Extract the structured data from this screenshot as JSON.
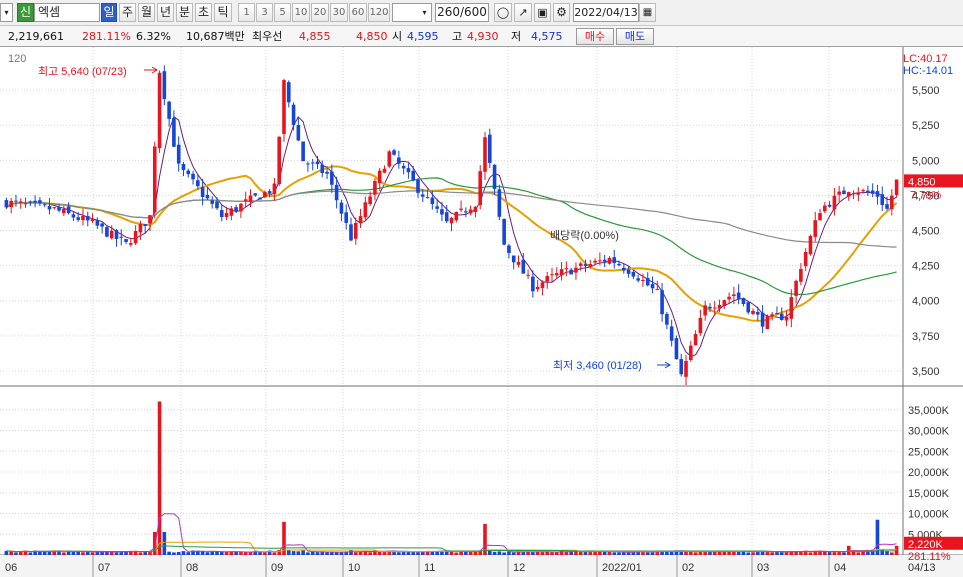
{
  "toolbar": {
    "market_badge": "신",
    "stock_name": "엑셈",
    "periods": [
      "일",
      "주",
      "월",
      "년",
      "분",
      "초",
      "틱"
    ],
    "intervals": [
      "1",
      "3",
      "5",
      "10",
      "20",
      "30",
      "60",
      "120"
    ],
    "count": "260/600",
    "date": "2022/04/13"
  },
  "info": {
    "volume": "2,219,661",
    "vol_ratio": "281.11%",
    "change_pct": "6.32%",
    "amount": "10,687백만",
    "best_bid_label": "최우선",
    "best_ask": "4,855",
    "best_bid": "4,850",
    "open_label": "시",
    "open": "4,595",
    "high_label": "고",
    "high": "4,930",
    "low_label": "저",
    "low": "4,575",
    "buy_label": "매수",
    "sell_label": "매도"
  },
  "chart_data": {
    "type": "candlestick",
    "ma_period_label": "120",
    "price_axis": {
      "ticks": [
        "5,500",
        "5,250",
        "5,000",
        "4,750",
        "4,500",
        "4,250",
        "4,000",
        "3,750",
        "3,500"
      ],
      "ylim": [
        3400,
        5750
      ]
    },
    "volume_axis": {
      "ticks": [
        "35,000K",
        "30,000K",
        "25,000K",
        "20,000K",
        "15,000K",
        "10,000K",
        "5,000K"
      ],
      "ylim": [
        0,
        40000
      ]
    },
    "x_labels": [
      "06",
      "07",
      "08",
      "09",
      "10",
      "11",
      "12",
      "2022/01",
      "02",
      "03",
      "04",
      "04/13"
    ],
    "current_price": "4,850",
    "current_change": "7.78%",
    "current_volume": "2,220K",
    "current_volume_ratio": "281.11%",
    "lc_label": "LC:40.17",
    "hc_label": "HC:-14.01",
    "annotations": {
      "high": "최고 5,640 (07/23)",
      "low": "최저 3,460 (01/28)",
      "dividend": "배당락(0.00%)"
    },
    "colors": {
      "up": "#e8141e",
      "down": "#1446d8",
      "ma5": "#6a1f7a",
      "ma20": "#e8a000",
      "ma60": "#2a9a3a",
      "ma120": "#8a8a8a"
    },
    "price_keypoints": [
      [
        0,
        4700
      ],
      [
        10,
        4650
      ],
      [
        18,
        4550
      ],
      [
        25,
        4400
      ],
      [
        30,
        4600
      ],
      [
        32,
        5640
      ],
      [
        36,
        4950
      ],
      [
        40,
        4800
      ],
      [
        45,
        4600
      ],
      [
        50,
        4700
      ],
      [
        56,
        4800
      ],
      [
        58,
        5550
      ],
      [
        62,
        5000
      ],
      [
        67,
        4900
      ],
      [
        72,
        4450
      ],
      [
        80,
        5050
      ],
      [
        86,
        4800
      ],
      [
        92,
        4550
      ],
      [
        98,
        4700
      ],
      [
        100,
        5150
      ],
      [
        104,
        4400
      ],
      [
        110,
        4100
      ],
      [
        116,
        4200
      ],
      [
        121,
        4250
      ],
      [
        126,
        4300
      ],
      [
        131,
        4200
      ],
      [
        136,
        4050
      ],
      [
        141,
        3460
      ],
      [
        146,
        3950
      ],
      [
        152,
        4050
      ],
      [
        158,
        3850
      ],
      [
        163,
        3900
      ],
      [
        166,
        4250
      ],
      [
        170,
        4650
      ],
      [
        176,
        4800
      ],
      [
        182,
        4750
      ],
      [
        184,
        4650
      ],
      [
        186,
        4850
      ]
    ],
    "volume_keypoints": [
      [
        32,
        37000
      ],
      [
        58,
        8000
      ],
      [
        100,
        7500
      ],
      [
        176,
        2200
      ],
      [
        182,
        8500
      ],
      [
        186,
        2220
      ]
    ]
  }
}
